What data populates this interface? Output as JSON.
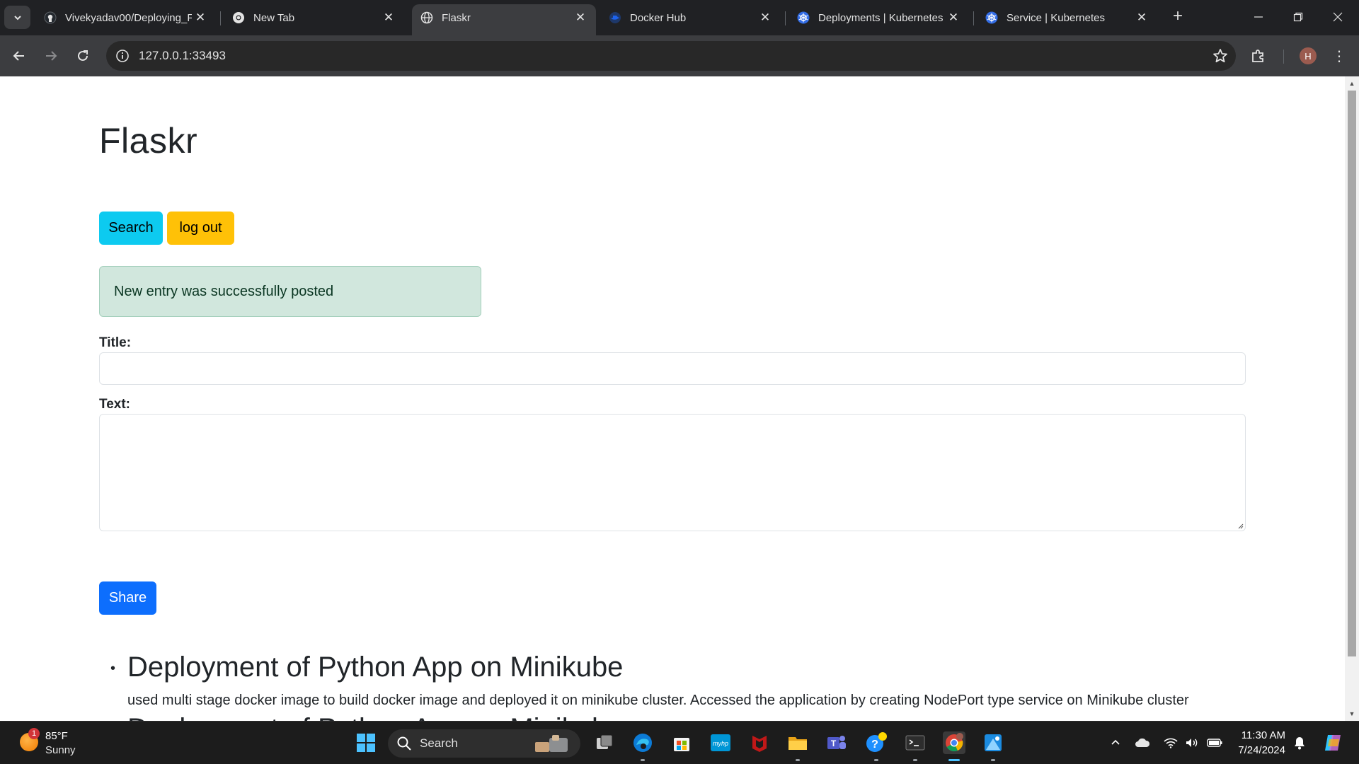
{
  "browser": {
    "tabs": [
      {
        "label": "Vivekyadav00/Deploying_F",
        "icon": "github-icon",
        "active": false
      },
      {
        "label": "New Tab",
        "icon": "chrome-icon",
        "active": false
      },
      {
        "label": "Flaskr",
        "icon": "globe-icon",
        "active": true
      },
      {
        "label": "Docker Hub",
        "icon": "docker-icon",
        "active": false
      },
      {
        "label": "Deployments | Kubernetes",
        "icon": "kubernetes-icon",
        "active": false
      },
      {
        "label": "Service | Kubernetes",
        "icon": "kubernetes-icon",
        "active": false
      }
    ],
    "address": "127.0.0.1:33493",
    "profile_initial": "H"
  },
  "page": {
    "title": "Flaskr",
    "search_label": "Search",
    "logout_label": "log out",
    "flash_message": "New entry was successfully posted",
    "title_field_label": "Title:",
    "text_field_label": "Text:",
    "title_value": "",
    "text_value": "",
    "share_label": "Share",
    "entries": [
      {
        "title": "Deployment of Python App on Minikube",
        "text": "used multi stage docker image to build docker image and deployed it on minikube cluster. Accessed the application by creating NodePort type service on Minikube cluster"
      },
      {
        "title": "Deployment of Python App on Minikube",
        "text": ""
      }
    ]
  },
  "taskbar": {
    "weather_temp": "85°F",
    "weather_condition": "Sunny",
    "weather_badge": "1",
    "search_label": "Search",
    "time": "11:30 AM",
    "date": "7/24/2024"
  },
  "colors": {
    "search_button": "#0dcaf0",
    "logout_button": "#ffc107",
    "share_button": "#0d6efd",
    "alert_bg": "#d1e7dd"
  }
}
